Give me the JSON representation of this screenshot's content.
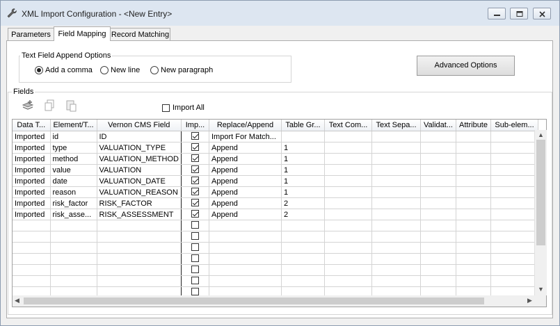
{
  "window": {
    "title": "XML Import Configuration - <New Entry>",
    "icons": [
      "wrench-icon",
      "minimize-icon",
      "restore-icon",
      "close-icon"
    ]
  },
  "tabs": [
    {
      "label": "Parameters",
      "active": false
    },
    {
      "label": "Field Mapping",
      "active": true
    },
    {
      "label": "Record Matching",
      "active": false
    }
  ],
  "append_options": {
    "group_label": "Text Field Append Options",
    "options": [
      {
        "label": "Add a comma",
        "selected": true
      },
      {
        "label": "New line",
        "selected": false
      },
      {
        "label": "New paragraph",
        "selected": false
      }
    ]
  },
  "advanced_button": "Advanced Options",
  "fields": {
    "group_label": "Fields",
    "toolbar_icons": [
      "add-layer-icon",
      "copy-icon",
      "paste-icon"
    ],
    "import_all_label": "Import All",
    "import_all_checked": false,
    "columns": [
      "Data T...",
      "Element/T...",
      "Vernon CMS Field",
      "Imp...",
      "Replace/Append",
      "Table Gr...",
      "Text Com...",
      "Text Sepa...",
      "Validat...",
      "Attribute",
      "Sub-elem..."
    ],
    "rows": [
      {
        "data_type": "Imported",
        "element": "id",
        "cms_field": "ID",
        "imported": true,
        "replace_append": "Import For Match...",
        "table_group": ""
      },
      {
        "data_type": "Imported",
        "element": "type",
        "cms_field": "VALUATION_TYPE",
        "imported": true,
        "replace_append": "Append",
        "table_group": "1"
      },
      {
        "data_type": "Imported",
        "element": "method",
        "cms_field": "VALUATION_METHOD",
        "imported": true,
        "replace_append": "Append",
        "table_group": "1"
      },
      {
        "data_type": "Imported",
        "element": "value",
        "cms_field": "VALUATION",
        "imported": true,
        "replace_append": "Append",
        "table_group": "1"
      },
      {
        "data_type": "Imported",
        "element": "date",
        "cms_field": "VALUATION_DATE",
        "imported": true,
        "replace_append": "Append",
        "table_group": "1"
      },
      {
        "data_type": "Imported",
        "element": "reason",
        "cms_field": "VALUATION_REASON",
        "imported": true,
        "replace_append": "Append",
        "table_group": "1"
      },
      {
        "data_type": "Imported",
        "element": "risk_factor",
        "cms_field": "RISK_FACTOR",
        "imported": true,
        "replace_append": "Append",
        "table_group": "2"
      },
      {
        "data_type": "Imported",
        "element": "risk_asse...",
        "cms_field": "RISK_ASSESSMENT",
        "imported": true,
        "replace_append": "Append",
        "table_group": "2"
      }
    ],
    "empty_rows": 7
  },
  "colors": {
    "titlebar": "#dde6f1",
    "window_bg": "#f0f0f0",
    "panel_bg": "#ffffff"
  }
}
